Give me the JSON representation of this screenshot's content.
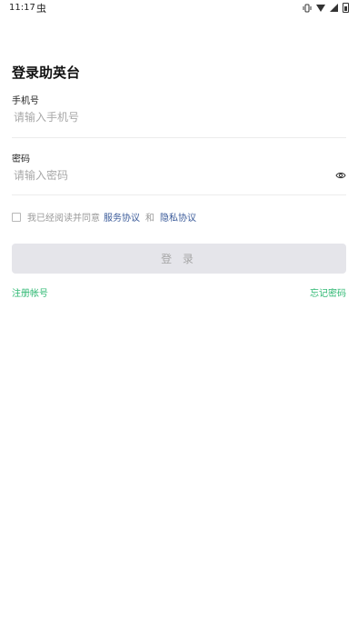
{
  "status_bar": {
    "time": "11:17",
    "notification_icon": "bug-icon",
    "icons": [
      "vibrate-icon",
      "wifi-icon",
      "signal-icon",
      "battery-icon"
    ]
  },
  "login": {
    "title": "登录助英台",
    "phone_label": "手机号",
    "phone_placeholder": "请输入手机号",
    "phone_value": "",
    "password_label": "密码",
    "password_placeholder": "请输入密码",
    "password_value": "",
    "agree_text": "我已经阅读并同意",
    "service_link": "服务协议",
    "and_text": "和",
    "privacy_link": "隐私协议",
    "agree_checked": false,
    "login_button": "登 录",
    "register_link": "注册帐号",
    "forgot_link": "忘记密码"
  },
  "colors": {
    "accent_green": "#2eb872",
    "link_blue": "#3b5b9a",
    "button_disabled_bg": "#e5e5ea"
  }
}
